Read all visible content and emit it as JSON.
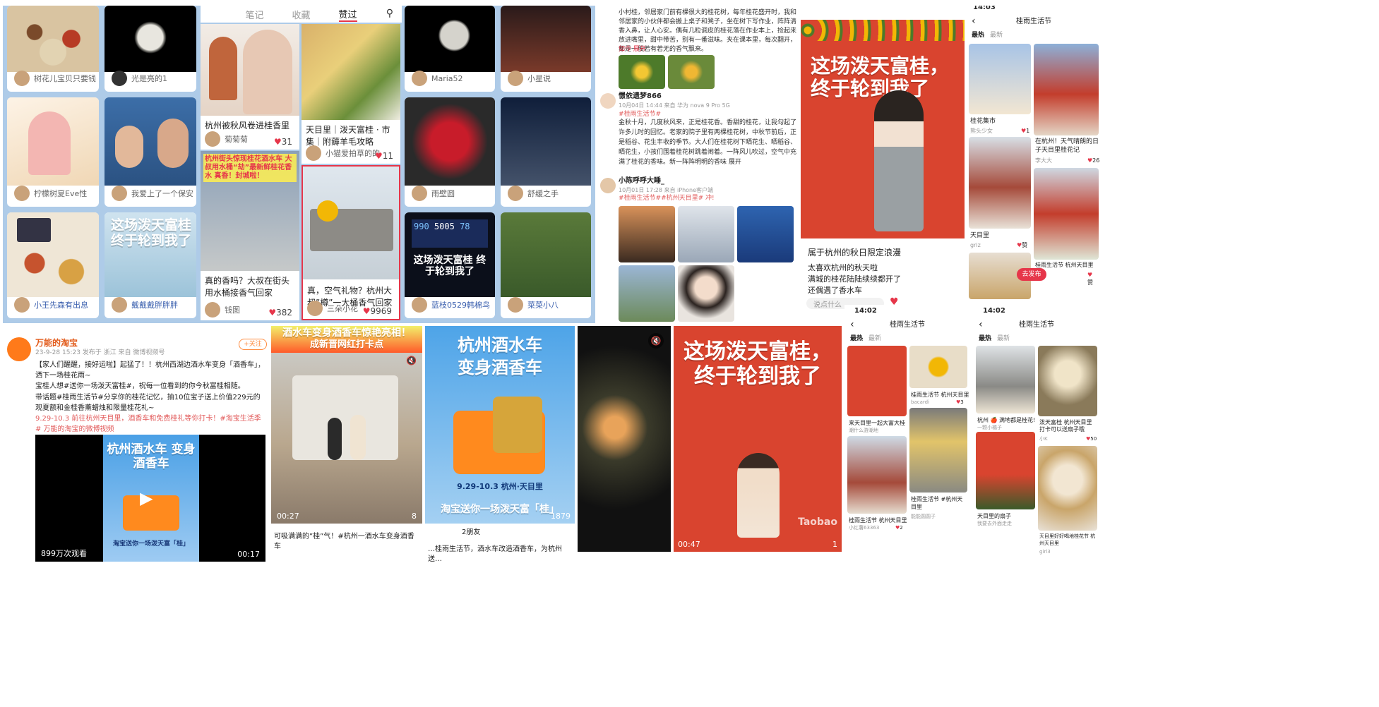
{
  "colors": {
    "accent": "#e6364a",
    "grid_bg": "#aecbe8",
    "osmanthus": "#f2b705",
    "banner_red": "#d9442f"
  },
  "p1": {
    "users": [
      "树花儿宝贝只要钱",
      "光是亮的1",
      "柠檬树夏Eve性",
      "我爱上了一个保安",
      "小王先森有出息",
      "戴戴戴胖胖胖"
    ]
  },
  "p2": {
    "tabs": [
      "笔记",
      "收藏",
      "赞过"
    ],
    "search_icon": "search-icon",
    "cards": [
      {
        "title": "杭州被秋风卷进桂香里",
        "user": "菊菊菊",
        "likes": "31"
      },
      {
        "title": "天目里｜泼天富桂 · 市集｜附薅羊毛攻略",
        "user": "小猫爱拍草的的",
        "likes": "11"
      },
      {
        "title": "真的香吗？大叔在街头用水桶接香气回家",
        "user": "钱图",
        "likes": "382",
        "overlay": "杭州街头惊现桂花酒水车 大叔用水桶“劫”最新鲜桂花香水 真香！封城啦！"
      },
      {
        "title": "真，空气礼物？杭州大叔”樽”一大桶香气回家",
        "user": "三朵小花",
        "likes": "9969"
      }
    ]
  },
  "p3": {
    "users": [
      "Maria52",
      "小星说",
      "雨壁圆",
      "舒缓之手",
      "蓝枝0529韩棉鸟",
      "菜菜小八"
    ],
    "display_values": [
      "990",
      "5005",
      "78"
    ],
    "banner": "这场泼天富桂 终于轮到我了"
  },
  "p4": {
    "intro": "小村桂，邻居家门前有棵很大的桂花树，每年桂花盛开时，我和邻居家的小伙伴都会搬上桌子和凳子，坐在树下写作业，阵阵清香入鼻，让人心安。偶有几粒调皮的桂花落在作业本上，捡起来放进嘴里，甜中带苦，别有一番滋味。夹在课本里，每次翻开，都是一股若有若无的香气飘来。",
    "more": "如今 展开",
    "post1": {
      "user": "憬依遗梦866",
      "meta": "10月04日 14:44 来自 华为 nova 9 Pro 5G",
      "tag": "#桂雨生活节#",
      "body": "金秋十月，几度秋风来，正是桂花香。香甜的桂花，让我勾起了许多儿时的回忆。老家的院子里有两棵桂花树，中秋节前后，正是稻谷、花生丰收的季节。大人们在桂花树下晒花生、晒稻谷、晒花生，小孩们围着桂花树跳着闹着。一阵风儿吹过，空气中充满了桂花的香味。新一阵阵明明的香味 展开"
    },
    "post2": {
      "user": "小陈呼呼大睡_",
      "meta": "10月01日 17:28 来自 iPhone客户端",
      "tags": "#桂雨生活节##杭州天目里# 冲!"
    }
  },
  "p5": {
    "banner": "这场泼天富桂，终于轮到我了",
    "title": "属于杭州的秋日限定浪漫",
    "lines": [
      "太喜欢杭州的秋天啦",
      "满城的桂花陆陆续续都开了",
      "还偶遇了香水车"
    ],
    "comment_placeholder": "说点什么"
  },
  "p6": {
    "time": "14:03",
    "title": "桂雨生活节",
    "tabs": [
      "最热",
      "最新"
    ],
    "items": [
      {
        "title": "桂花集市",
        "user": "熊头少女",
        "likes": "1"
      },
      {
        "title": "在杭州！天气晴朗的日子天目里桂花记",
        "user": "李大大",
        "likes": "26"
      },
      {
        "title": "天目里",
        "user": "griz",
        "likes": "赞"
      },
      {
        "title": "桂雨生活节 杭州天目里",
        "user": "",
        "likes": "赞"
      }
    ],
    "fab": "去发布"
  },
  "p7": {
    "user": "万能的淘宝",
    "follow": "+关注",
    "meta": "23-9-28 15:23 发布于 浙江 来自 微博视频号",
    "text1": "【家人们醒醒，接好运啦】起猛了！！杭州西湖边酒水车变身「酒香车」，洒下一场桂花雨~",
    "text2": "宝桂人想#送你一场泼天富桂#，祝每一位看到的你今秋富桂相随。",
    "text3": "带话题#桂雨生活节#分享你的桂花记忆，抽10位宝子送上价值229元的观夏额和金桂香薰蜡烛和限量桂花礼~",
    "text4": "9.29-10.3 前往杭州天目里，酒香车和免费桂礼等你打卡！#淘宝生活季# 万能的淘宝的微博视频",
    "video_title": "杭州酒水车 变身酒香车",
    "video_sub": "淘宝送你一场泼天富「桂」",
    "views": "899万次观看",
    "duration": "00:17"
  },
  "p8": {
    "headline1": "酒水车变身酒香车惊艳亮相！",
    "headline2": "成新晋网红打卡点",
    "time": "00:27",
    "likes": "8",
    "caption": "可吸满满的”桂”气！#杭州一酒水车变身酒香车"
  },
  "p9": {
    "title1": "杭州酒水车",
    "title2": "变身酒香车",
    "date": "9.29-10.3 杭州·天目里",
    "slogan": "淘宝送你一场泼天富「桂」",
    "likes": "1879",
    "friends": "2朋友",
    "caption": "…桂雨生活节，酒水车改造酒香车，为杭州送…"
  },
  "p10": {
    "mute_icon": "mute-icon"
  },
  "p11": {
    "banner": "这场泼天富桂，终于轮到我了",
    "time": "00:47",
    "likes": "1",
    "watermark": "Taobao"
  },
  "p12": {
    "time": "14:02",
    "title": "桂雨生活节",
    "tabs": [
      "最热",
      "最新"
    ],
    "items": [
      {
        "title": "来天目里一起大富大桂",
        "user": "潮什么游潮地",
        "likes": "赞"
      },
      {
        "title": "桂雨生活节 杭州天目里",
        "user": "bacardi",
        "likes": "3"
      },
      {
        "title": "桂雨生活节 杭州天目里",
        "user": "小红薯63363",
        "likes": "2"
      },
      {
        "title": "桂雨生活节 #杭州天目里",
        "user": "能能圆圆子",
        "likes": "赞"
      }
    ]
  },
  "p13": {
    "time": "14:02",
    "title": "桂雨生活节",
    "tabs": [
      "最热",
      "最新"
    ],
    "items": [
      {
        "title": "杭州 🍎 满地都是桂花!",
        "user": "一颗小橘子",
        "likes": "赞"
      },
      {
        "title": "泼天富桂 杭州天目里打卡可以送扇子哦",
        "user": "小K",
        "likes": "50"
      },
      {
        "title": "天目里的扇子",
        "user": "我要去外面走走",
        "likes": "赞"
      },
      {
        "title": "天目里好好喝地桂花节 杭州天目里",
        "user": "girl3",
        "likes": "赞"
      }
    ]
  }
}
